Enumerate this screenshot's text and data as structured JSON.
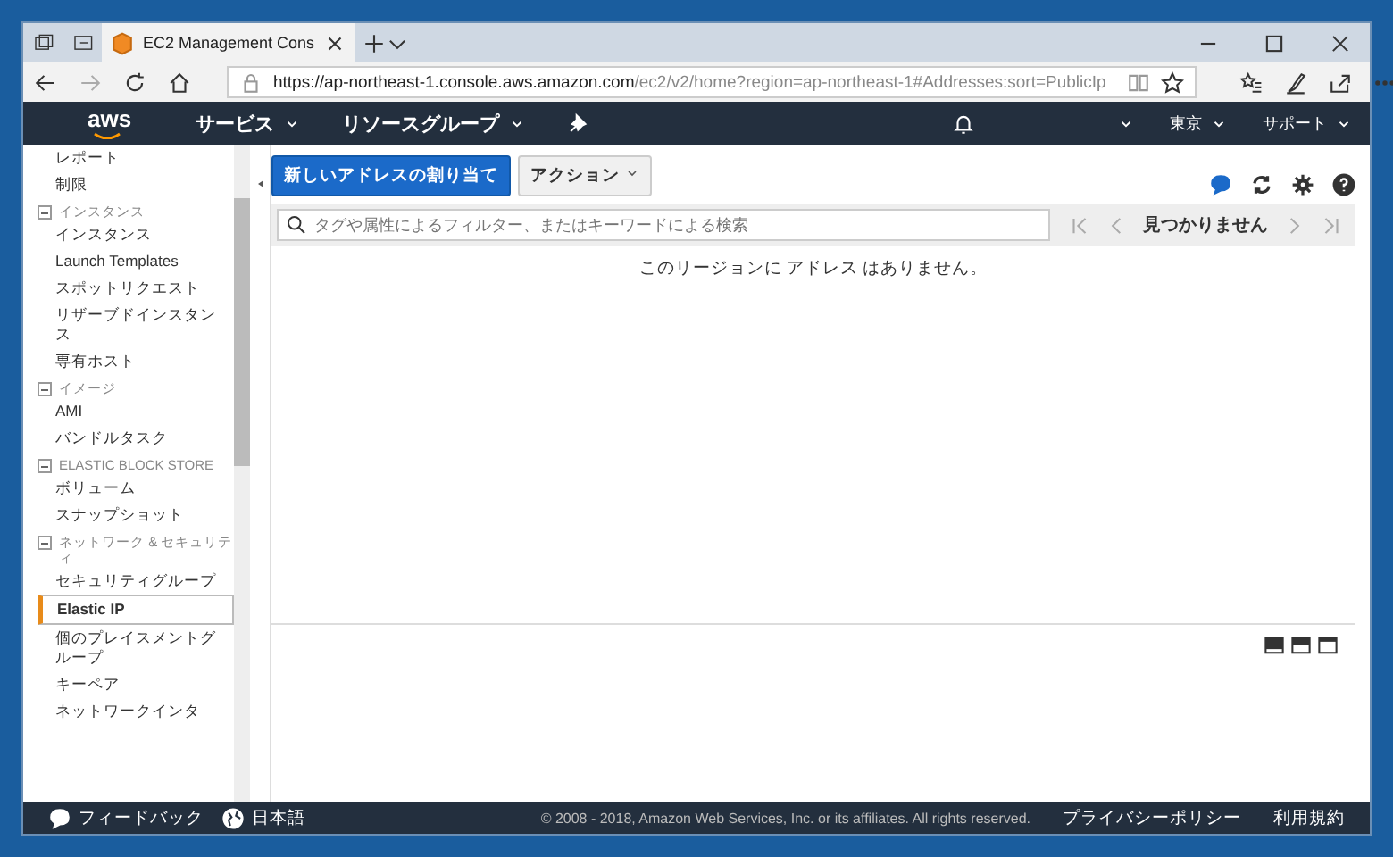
{
  "browser": {
    "tab_title": "EC2 Management Cons",
    "url_host": "https://ap-northeast-1.console.aws.amazon.com",
    "url_path": "/ec2/v2/home?region=ap-northeast-1#Addresses:sort=PublicIp"
  },
  "nav": {
    "logo": "aws",
    "menus": [
      {
        "label": "サービス"
      },
      {
        "label": "リソースグループ"
      }
    ],
    "region": "東京",
    "support": "サポート"
  },
  "sidebar": {
    "items": [
      {
        "kind": "item",
        "label": "レポート",
        "selected": false
      },
      {
        "kind": "item",
        "label": "制限",
        "selected": false
      },
      {
        "kind": "section",
        "label": "インスタンス",
        "expanded": true
      },
      {
        "kind": "item",
        "label": "インスタンス",
        "selected": false
      },
      {
        "kind": "item",
        "label": "Launch Templates",
        "selected": false
      },
      {
        "kind": "item",
        "label": "スポットリクエスト",
        "selected": false
      },
      {
        "kind": "item",
        "label": "リザーブドインスタンス",
        "selected": false
      },
      {
        "kind": "item",
        "label": "専有ホスト",
        "selected": false
      },
      {
        "kind": "section",
        "label": "イメージ",
        "expanded": true
      },
      {
        "kind": "item",
        "label": "AMI",
        "selected": false
      },
      {
        "kind": "item",
        "label": "バンドルタスク",
        "selected": false
      },
      {
        "kind": "section",
        "label": "ELASTIC BLOCK STORE",
        "expanded": true
      },
      {
        "kind": "item",
        "label": "ボリューム",
        "selected": false
      },
      {
        "kind": "item",
        "label": "スナップショット",
        "selected": false
      },
      {
        "kind": "section",
        "label": "ネットワーク & セキュリティ",
        "expanded": true
      },
      {
        "kind": "item",
        "label": "セキュリティグループ",
        "selected": false
      },
      {
        "kind": "item",
        "label": "Elastic IP",
        "selected": true
      },
      {
        "kind": "item",
        "label": "個のプレイスメントグループ",
        "selected": false
      },
      {
        "kind": "item",
        "label": "キーペア",
        "selected": false
      },
      {
        "kind": "item",
        "label": "ネットワークインタ",
        "selected": false
      }
    ]
  },
  "toolbar": {
    "primary_button": "新しいアドレスの割り当て",
    "actions_button": "アクション"
  },
  "search": {
    "placeholder": "タグや属性によるフィルター、またはキーワードによる検索"
  },
  "pagination": {
    "text": "見つかりません"
  },
  "empty_message": "このリージョンに アドレス はありません。",
  "footer": {
    "feedback": "フィードバック",
    "language": "日本語",
    "copyright": "© 2008 - 2018, Amazon Web Services, Inc. or its affiliates. All rights reserved.",
    "links": [
      "プライバシーポリシー",
      "利用規約"
    ]
  }
}
